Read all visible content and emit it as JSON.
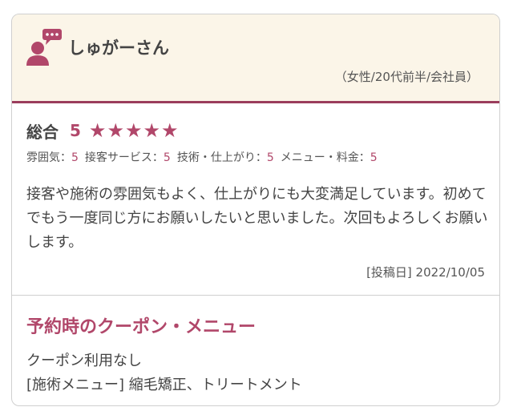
{
  "review": {
    "reviewer_name": "しゅがーさん",
    "profile": "（女性/20代前半/会社員）",
    "rating_label": "総合",
    "rating_value": "5",
    "stars": 5,
    "sub_ratings": [
      {
        "label": "雰囲気：",
        "value": "5"
      },
      {
        "label": "接客サービス：",
        "value": "5"
      },
      {
        "label": "技術・仕上がり：",
        "value": "5"
      },
      {
        "label": "メニュー・料金：",
        "value": "5"
      }
    ],
    "comment": "接客や施術の雰囲気もよく、仕上がりにも大変満足しています。初めてでもう一度同じ方にお願いしたいと思いました。次回もよろしくお願いします。",
    "posted_label": "[投稿日] 2022/10/05"
  },
  "coupon": {
    "title": "予約時のクーポン・メニュー",
    "line1": "クーポン利用なし",
    "line2": "[施術メニュー] 縮毛矯正、トリートメント"
  },
  "colors": {
    "accent": "#b1476a",
    "header_bg": "#fbf5e8",
    "header_border": "#9b3d5c"
  },
  "icons": {
    "avatar": "user-comment-icon",
    "star": "star-icon"
  }
}
